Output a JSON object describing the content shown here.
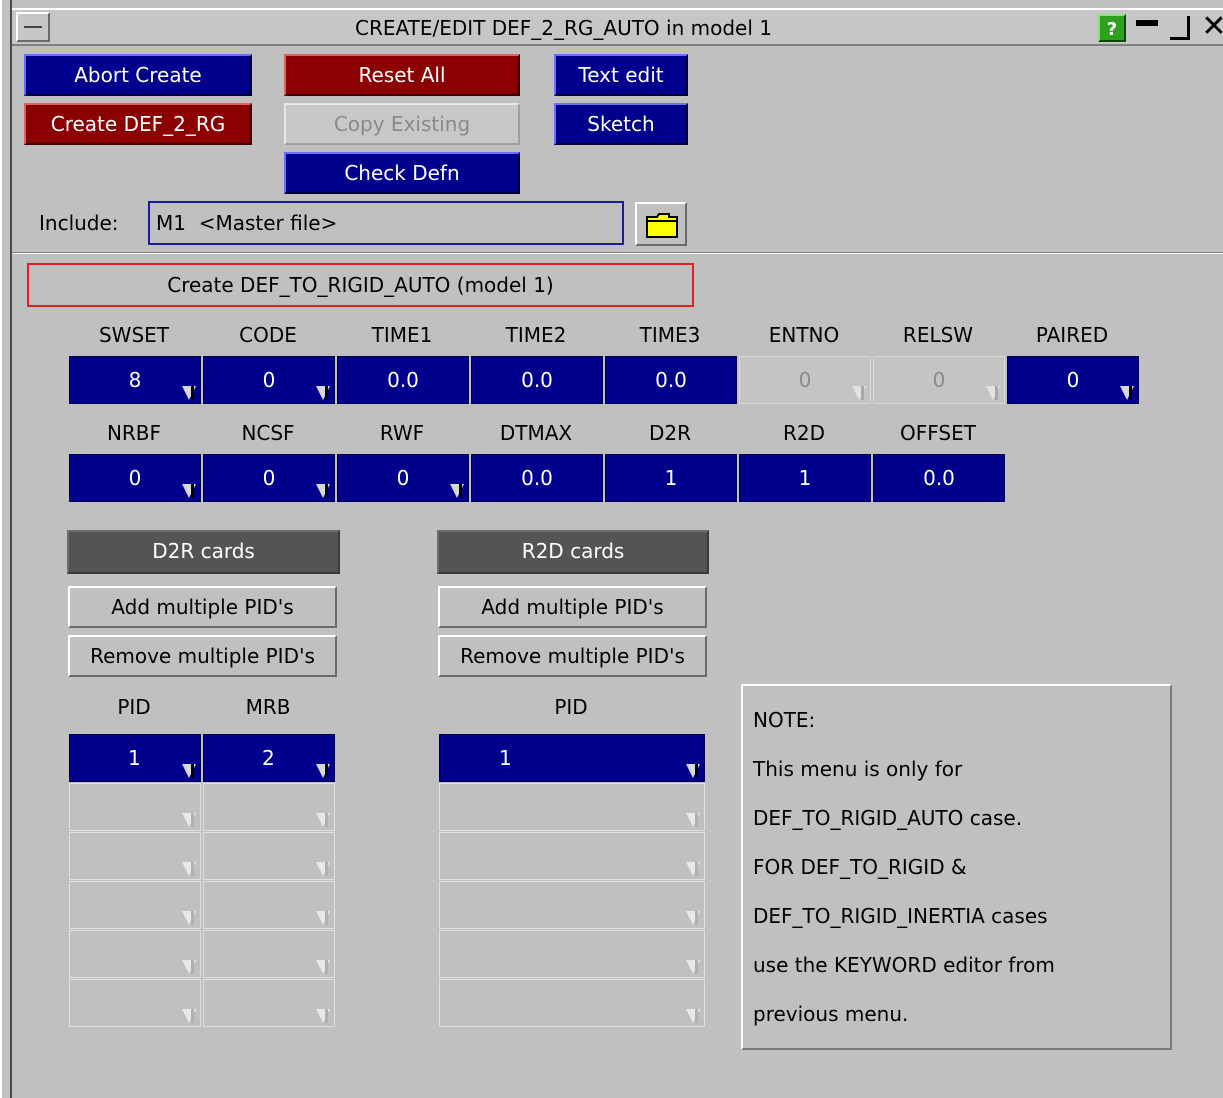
{
  "window": {
    "title": "CREATE/EDIT DEF_2_RG_AUTO in model 1",
    "help_label": "?"
  },
  "toolbar": {
    "abort_label": "Abort Create",
    "reset_label": "Reset All",
    "text_edit_label": "Text edit",
    "create_label": "Create DEF_2_RG",
    "copy_label": "Copy Existing",
    "sketch_label": "Sketch",
    "check_label": "Check Defn"
  },
  "include": {
    "label": "Include:",
    "value": "M1  <Master file>"
  },
  "section_title": "Create DEF_TO_RIGID_AUTO (model 1)",
  "row1": {
    "headers": [
      "SWSET",
      "CODE",
      "TIME1",
      "TIME2",
      "TIME3",
      "ENTNO",
      "RELSW",
      "PAIRED"
    ],
    "values": [
      "8",
      "0",
      "0.0",
      "0.0",
      "0.0",
      "0",
      "0",
      "0"
    ]
  },
  "row2": {
    "headers": [
      "NRBF",
      "NCSF",
      "RWF",
      "DTMAX",
      "D2R",
      "R2D",
      "OFFSET"
    ],
    "values": [
      "0",
      "0",
      "0",
      "0.0",
      "1",
      "1",
      "0.0"
    ]
  },
  "d2r": {
    "title": "D2R cards",
    "add_label": "Add multiple PID's",
    "remove_label": "Remove multiple PID's",
    "col_pid": "PID",
    "col_mrb": "MRB",
    "rows": [
      {
        "pid": "1",
        "mrb": "2"
      }
    ]
  },
  "r2d": {
    "title": "R2D cards",
    "add_label": "Add multiple PID's",
    "remove_label": "Remove multiple PID's",
    "col_pid": "PID",
    "rows": [
      {
        "pid": "1"
      }
    ]
  },
  "note": {
    "lines": [
      "NOTE:",
      "This menu is only for",
      "DEF_TO_RIGID_AUTO case.",
      "FOR DEF_TO_RIGID &",
      "DEF_TO_RIGID_INERTIA cases",
      "use the KEYWORD editor from",
      "previous menu."
    ]
  },
  "colors": {
    "field_blue": "#00008c",
    "button_red": "#8b0000",
    "panel_grey": "#c0c0c0",
    "header_dark": "#545454",
    "highlight_red": "#e02020"
  },
  "icons": [
    "menu-icon",
    "help-icon",
    "minimize-icon",
    "maximize-icon",
    "close-icon",
    "folder-icon",
    "dropdown-arrow-icon"
  ]
}
